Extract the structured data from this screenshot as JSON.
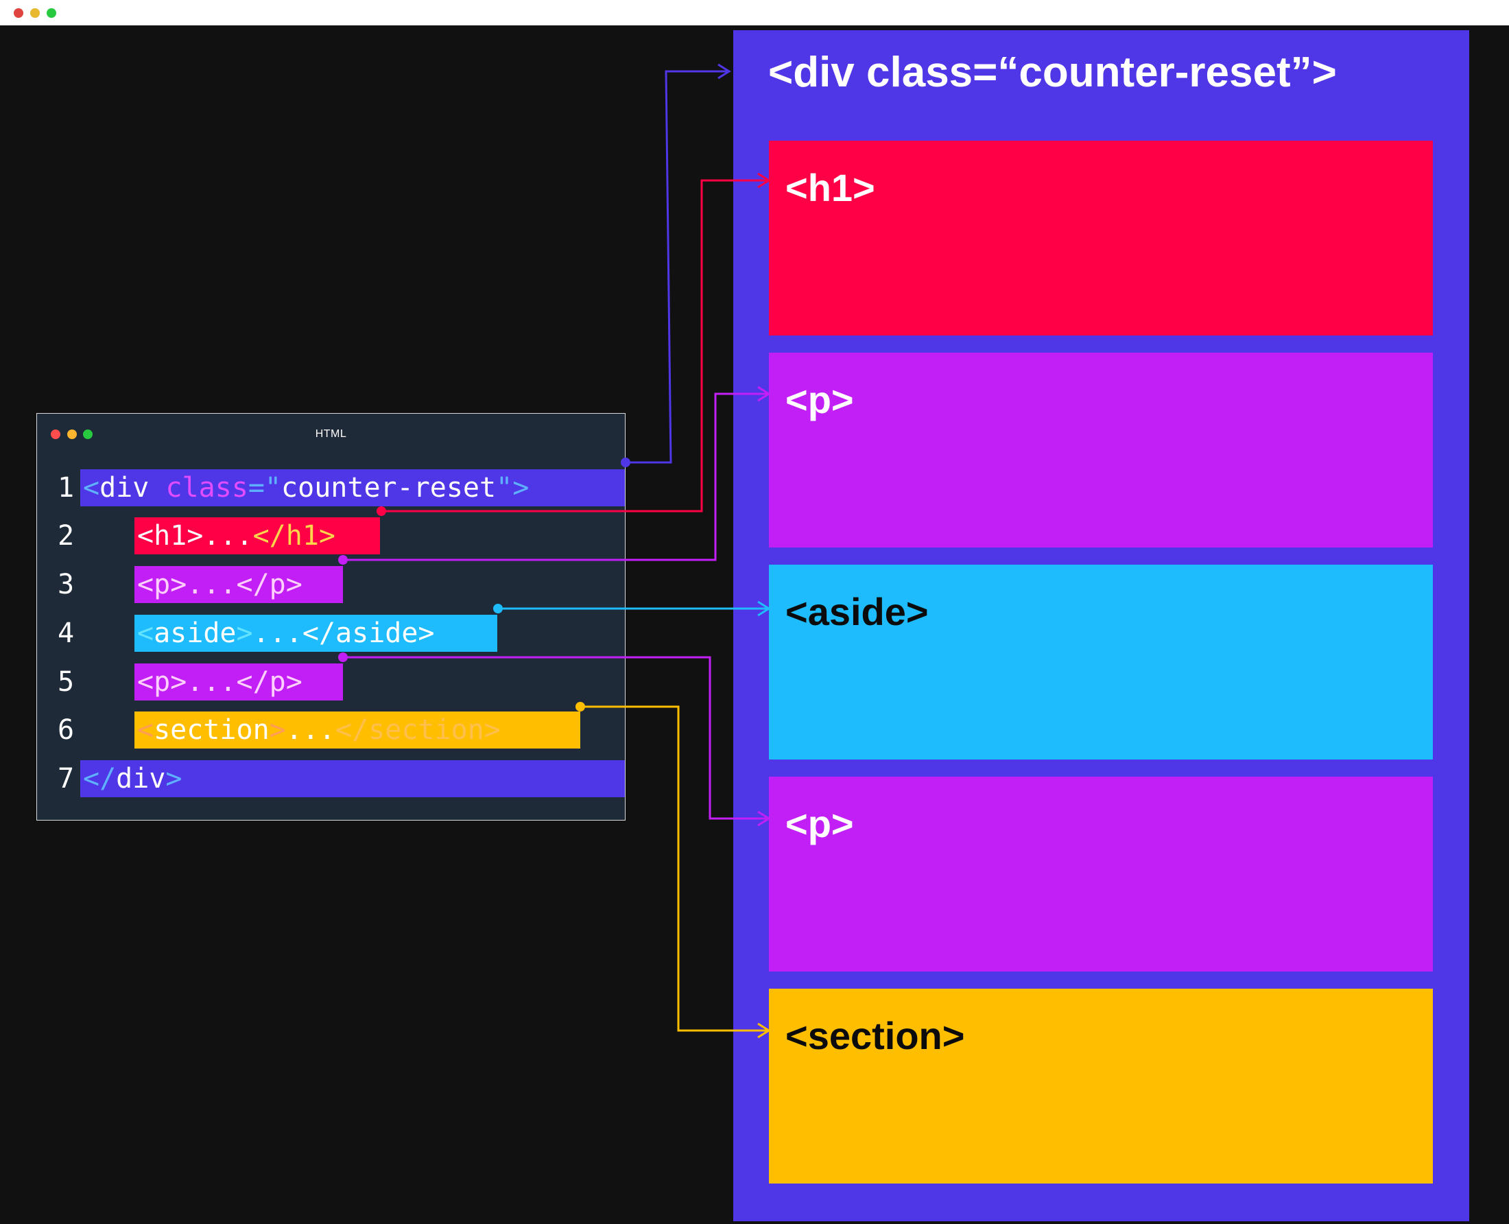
{
  "window_chrome": {
    "dots": [
      "#e0443e",
      "#e8b830",
      "#27c93f"
    ]
  },
  "editor": {
    "title": "HTML",
    "dots": [
      "#ff4d4d",
      "#ffb52e",
      "#27c93f"
    ],
    "lines": [
      {
        "num": "1",
        "segments": [
          "<",
          "div",
          " ",
          "class",
          "=\"",
          "counter-reset",
          "\">"
        ]
      },
      {
        "num": "2",
        "segments": [
          "<h1>...",
          "</h1>"
        ]
      },
      {
        "num": "3",
        "segments": [
          "<p>...</p>"
        ]
      },
      {
        "num": "4",
        "segments": [
          "<",
          "aside",
          ">",
          "...",
          "</aside>"
        ]
      },
      {
        "num": "5",
        "segments": [
          "<p>...</p>"
        ]
      },
      {
        "num": "6",
        "segments": [
          "<",
          "section",
          ">",
          "...",
          "</section>"
        ]
      },
      {
        "num": "7",
        "segments": [
          "</",
          "div",
          ">"
        ]
      }
    ]
  },
  "render": {
    "title": "<div class=“counter-reset”>",
    "blocks": [
      {
        "label": "<h1>",
        "color": "#ff0046",
        "text_color": "#ffffff"
      },
      {
        "label": "<p>",
        "color": "#c21ff7",
        "text_color": "#ffffff"
      },
      {
        "label": "<aside>",
        "color": "#1ebcfd",
        "text_color": "#0b0b0b"
      },
      {
        "label": "<p>",
        "color": "#c21ff7",
        "text_color": "#ffffff"
      },
      {
        "label": "<section>",
        "color": "#ffbf00",
        "text_color": "#0b0b0b"
      }
    ]
  },
  "colors": {
    "background": "#111111",
    "div": "#4f36e6",
    "h1": "#ff0046",
    "p": "#c21ff7",
    "aside": "#1ebcfd",
    "section": "#ffbf00"
  }
}
